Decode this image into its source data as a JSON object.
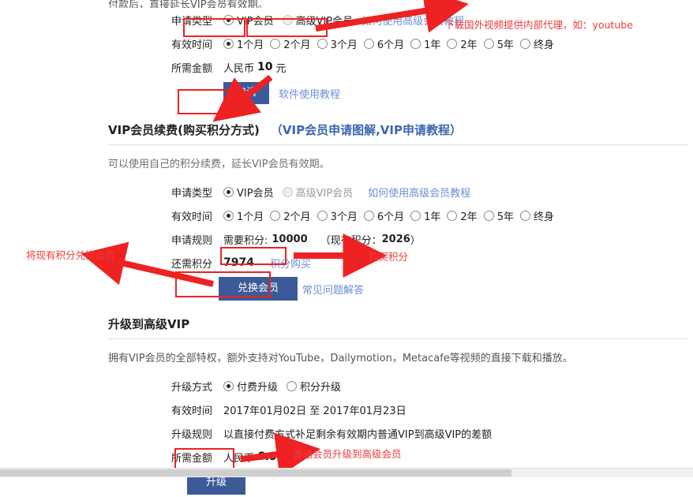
{
  "top_cut_text": "付款后，直接延长VIP会员有效期。",
  "section_renew_money": {
    "rows": {
      "apply_type_label": "申请类型",
      "valid_time_label": "有效时间",
      "amount_label": "所需金额"
    },
    "apply_types": [
      {
        "label": "VIP会员",
        "checked": true,
        "disabled": false
      },
      {
        "label": "高级VIP会员",
        "checked": false,
        "disabled": true
      }
    ],
    "apply_type_link": "如何使用高级会员教程",
    "durations": [
      {
        "label": "1个月",
        "checked": true
      },
      {
        "label": "2个月",
        "checked": false
      },
      {
        "label": "3个月",
        "checked": false
      },
      {
        "label": "6个月",
        "checked": false
      },
      {
        "label": "1年",
        "checked": false
      },
      {
        "label": "2年",
        "checked": false
      },
      {
        "label": "5年",
        "checked": false
      },
      {
        "label": "终身",
        "checked": false
      }
    ],
    "currency": "人民币",
    "amount": "10",
    "unit": "元",
    "submit_label": "申请",
    "submit_side_link": "软件使用教程"
  },
  "section_renew_points": {
    "title": "VIP会员续费(购买积分方式)",
    "title_link": "（VIP会员申请图解,VIP申请教程）",
    "desc": "可以使用自己的积分续费，延长VIP会员有效期。",
    "rows": {
      "apply_type_label": "申请类型",
      "valid_time_label": "有效时间",
      "rule_label": "申请规则",
      "need_label": "还需积分"
    },
    "apply_types": [
      {
        "label": "VIP会员",
        "checked": true,
        "disabled": false
      },
      {
        "label": "高级VIP会员",
        "checked": false,
        "disabled": true
      }
    ],
    "apply_type_link": "如何使用高级会员教程",
    "durations": [
      {
        "label": "1个月",
        "checked": true
      },
      {
        "label": "2个月",
        "checked": false
      },
      {
        "label": "3个月",
        "checked": false
      },
      {
        "label": "6个月",
        "checked": false
      },
      {
        "label": "1年",
        "checked": false
      },
      {
        "label": "2年",
        "checked": false
      },
      {
        "label": "5年",
        "checked": false
      },
      {
        "label": "终身",
        "checked": false
      }
    ],
    "rule_need_prefix": "需要积分:",
    "rule_need_value": "10000",
    "rule_own_text": "（现有积分：",
    "rule_own_value": "2026",
    "rule_own_suffix": "）",
    "need_points_value": "7974",
    "buy_points_link": "积分购买",
    "submit_label": "兑换会员",
    "submit_side_link": "常见问题解答"
  },
  "section_upgrade": {
    "title": "升级到高级VIP",
    "desc": "拥有VIP会员的全部特权，额外支持对YouTube，Dailymotion，Metacafe等视频的直接下载和播放。",
    "rows": {
      "method_label": "升级方式",
      "valid_time_label": "有效时间",
      "rule_label": "升级规则",
      "amount_label": "所需金额"
    },
    "methods": [
      {
        "label": "付费升级",
        "checked": true
      },
      {
        "label": "积分升级",
        "checked": false
      }
    ],
    "valid_time_value": "2017年01月02日 至 2017年01月23日",
    "rule_value": "以直接付费方式补足剩余有效期内普通VIP到高级VIP的差额",
    "currency": "人民币",
    "amount": "6.99",
    "unit": "元",
    "submit_label": "升级"
  },
  "annotations": {
    "proxy_note": "下载国外视频提供内部代理，如：youtube",
    "exchange_note": "将现有积分兑换会员",
    "buy_points_note": "购买积分",
    "upgrade_note": "普通会员升级到高级会员"
  },
  "colors": {
    "button": "#3d5a98",
    "annotation": "#ee3b3b",
    "link": "#6b8fd4",
    "heading_link": "#3b66b0"
  }
}
